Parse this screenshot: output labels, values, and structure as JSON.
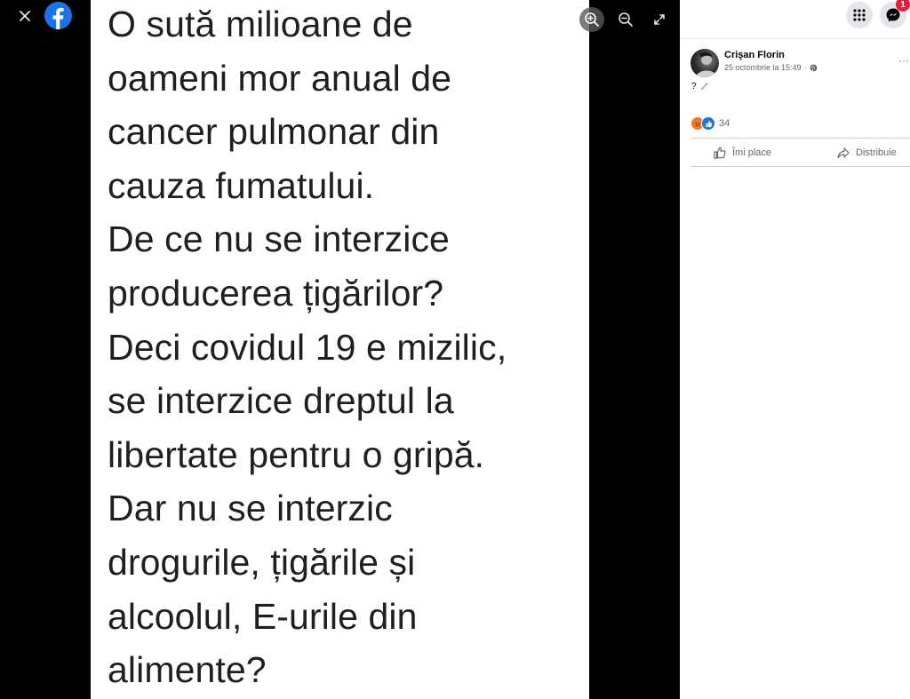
{
  "viewer": {
    "close_icon": "close-icon",
    "logo_icon": "facebook-logo-icon",
    "zoom_in_icon": "zoom-in-icon",
    "zoom_out_icon": "zoom-out-icon",
    "fullscreen_icon": "expand-icon"
  },
  "photo": {
    "text": "O sută milioane de\noameni mor anual de\ncancer pulmonar din\ncauza fumatului.\nDe ce nu se interzice\nproducerea țigărilor?\nDeci covidul 19 e mizilic,\nse interzice dreptul la\nlibertate pentru o gripă.\nDar nu se interzic\ndrogurile, țigările și\nalcoolul, E-urile din\nalimente?"
  },
  "topbar": {
    "menu_icon": "grid-menu-icon",
    "messenger_icon": "messenger-icon",
    "notification_count": "1"
  },
  "post": {
    "author": "Crişan Florin",
    "timestamp": "25 octombrie la 15:49",
    "separator": "·",
    "privacy_icon": "globe-icon",
    "more_icon": "more-options-icon",
    "more_label": "···",
    "caption_text": "?",
    "caption_emoji": "syringe-icon",
    "reactions": {
      "types": [
        "angry",
        "like"
      ],
      "count": "34"
    },
    "actions": {
      "like_label": "Îmi place",
      "share_label": "Distribuie"
    }
  },
  "colors": {
    "accent_blue": "#1b74e4",
    "badge_red": "#e41e3f",
    "angry_orange": "#f07a2b",
    "muted_text": "#65676b"
  }
}
